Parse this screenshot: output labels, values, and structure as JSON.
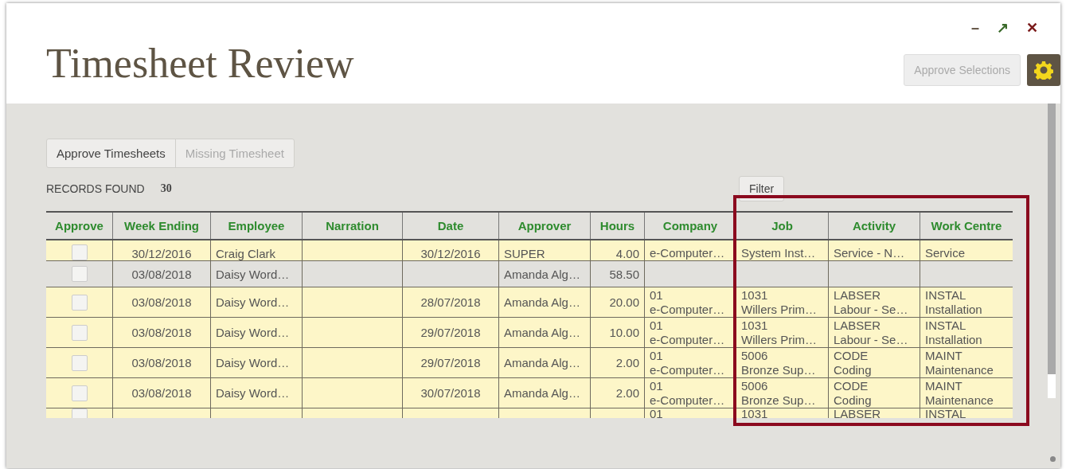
{
  "window": {
    "title": "Timesheet Review",
    "controls": [
      "–",
      "↗",
      "✕"
    ]
  },
  "approve_selections": {
    "label": "Approve Selections",
    "disabled": true
  },
  "tabs": [
    {
      "label": "Approve Timesheets",
      "selected": true
    },
    {
      "label": "Missing Timesheet",
      "selected": false
    }
  ],
  "records": {
    "label": "RECORDS FOUND",
    "count": "30"
  },
  "filter_button": "Filter",
  "table": {
    "columns": [
      "Approve",
      "Week Ending",
      "Employee",
      "Narration",
      "Date",
      "Approver",
      "Hours",
      "Company",
      "Job",
      "Activity",
      "Work Centre"
    ],
    "rows": [
      {
        "kind": "cut_top",
        "checked": false,
        "week_ending": "30/12/2016",
        "employee": "Craig Clark",
        "date": "30/12/2016",
        "approver": "SUPER",
        "hours": "4.00",
        "company": [
          "e-Computer…"
        ],
        "job": [
          "System Inst…"
        ],
        "activity": [
          "Service - N…"
        ],
        "work_centre": [
          "Service"
        ]
      },
      {
        "kind": "total",
        "checked": false,
        "week_ending": "03/08/2018",
        "employee": "Daisy Word…",
        "approver": "Amanda Alg…",
        "hours": "58.50"
      },
      {
        "kind": "entry",
        "checked": false,
        "week_ending": "03/08/2018",
        "employee": "Daisy Word…",
        "date": "28/07/2018",
        "approver": "Amanda Alg…",
        "hours": "20.00",
        "company": [
          "01",
          "e-Computer…"
        ],
        "job": [
          "1031",
          "Willers Prim…"
        ],
        "activity": [
          "LABSER",
          "Labour - Se…"
        ],
        "work_centre": [
          "INSTAL",
          "Installation"
        ]
      },
      {
        "kind": "entry",
        "checked": false,
        "week_ending": "03/08/2018",
        "employee": "Daisy Word…",
        "date": "29/07/2018",
        "approver": "Amanda Alg…",
        "hours": "10.00",
        "company": [
          "01",
          "e-Computer…"
        ],
        "job": [
          "1031",
          "Willers Prim…"
        ],
        "activity": [
          "LABSER",
          "Labour - Se…"
        ],
        "work_centre": [
          "INSTAL",
          "Installation"
        ]
      },
      {
        "kind": "entry",
        "checked": false,
        "week_ending": "03/08/2018",
        "employee": "Daisy Word…",
        "date": "29/07/2018",
        "approver": "Amanda Alg…",
        "hours": "2.00",
        "company": [
          "01",
          "e-Computer…"
        ],
        "job": [
          "5006",
          "Bronze Sup…"
        ],
        "activity": [
          "CODE",
          "Coding"
        ],
        "work_centre": [
          "MAINT",
          "Maintenance"
        ]
      },
      {
        "kind": "entry",
        "checked": false,
        "week_ending": "03/08/2018",
        "employee": "Daisy Word…",
        "date": "30/07/2018",
        "approver": "Amanda Alg…",
        "hours": "2.00",
        "company": [
          "01",
          "e-Computer…"
        ],
        "job": [
          "5006",
          "Bronze Sup…"
        ],
        "activity": [
          "CODE",
          "Coding"
        ],
        "work_centre": [
          "MAINT",
          "Maintenance"
        ]
      },
      {
        "kind": "cut_bottom",
        "checked": false,
        "company": [
          "01"
        ],
        "job": [
          "1031"
        ],
        "activity": [
          "LABSER"
        ],
        "work_centre": [
          "INSTAL"
        ]
      }
    ]
  }
}
